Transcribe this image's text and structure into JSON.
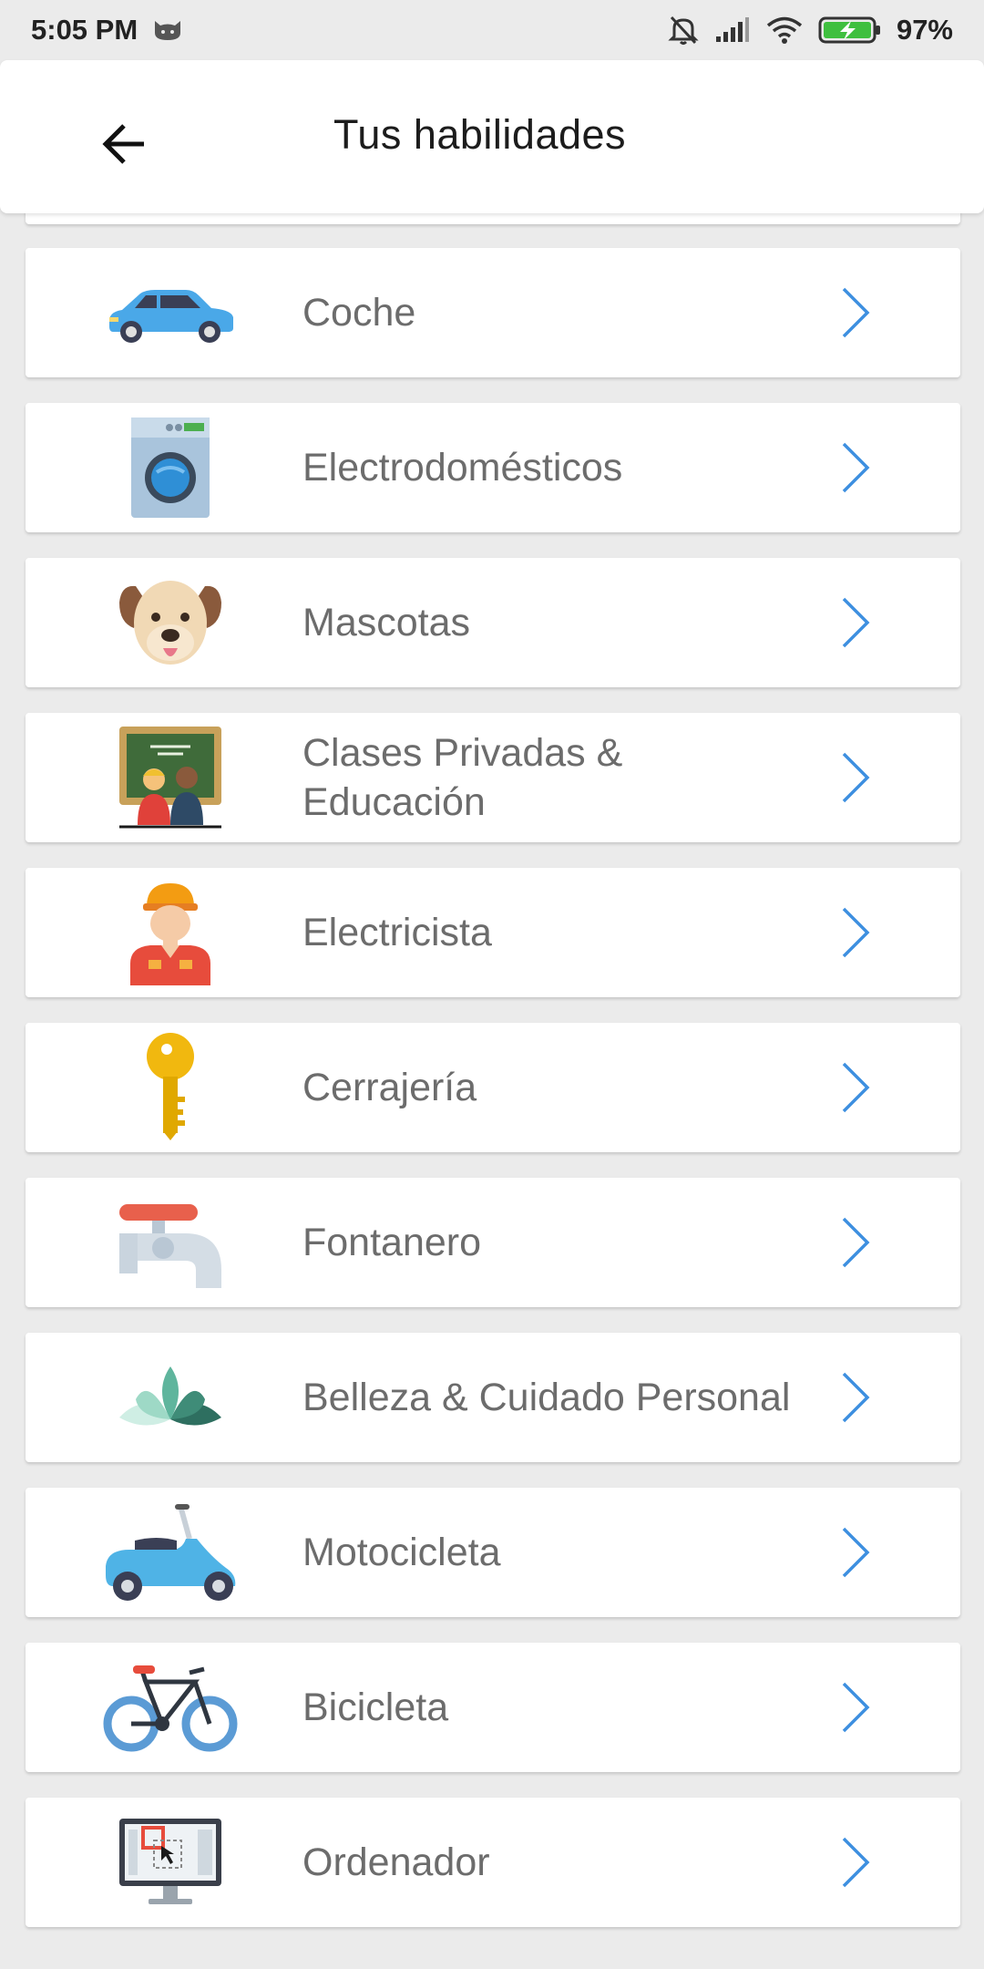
{
  "status": {
    "time": "5:05 PM",
    "battery": "97%"
  },
  "header": {
    "title": "Tus habilidades",
    "back_icon": "arrow-left-icon"
  },
  "colors": {
    "accent": "#3d8fe0",
    "label": "#6c6c6c",
    "background": "#ebebeb"
  },
  "skills": [
    {
      "label": "Coche",
      "icon": "car-icon"
    },
    {
      "label": "Electrodomésticos",
      "icon": "washing-machine-icon"
    },
    {
      "label": "Mascotas",
      "icon": "dog-icon"
    },
    {
      "label": "Clases Privadas & Educación",
      "icon": "classroom-icon"
    },
    {
      "label": "Electricista",
      "icon": "electrician-icon"
    },
    {
      "label": "Cerrajería",
      "icon": "key-icon"
    },
    {
      "label": "Fontanero",
      "icon": "faucet-icon"
    },
    {
      "label": "Belleza & Cuidado Personal",
      "icon": "lotus-icon"
    },
    {
      "label": "Motocicleta",
      "icon": "scooter-icon"
    },
    {
      "label": "Bicicleta",
      "icon": "bicycle-icon"
    },
    {
      "label": "Ordenador",
      "icon": "computer-icon"
    }
  ]
}
